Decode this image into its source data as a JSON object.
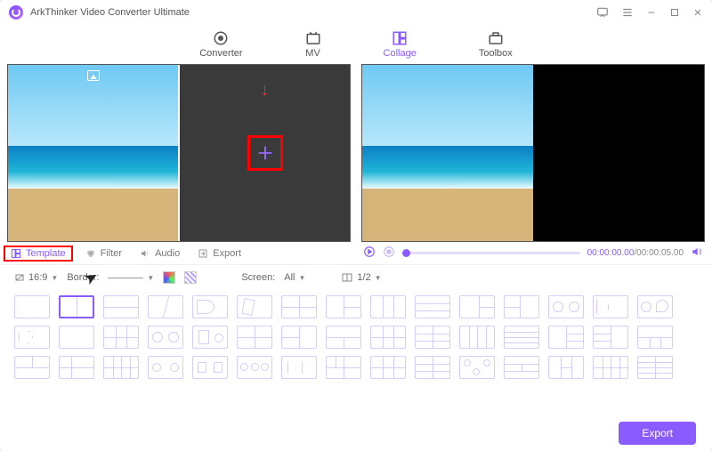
{
  "title": "ArkThinker Video Converter Ultimate",
  "nav": {
    "converter": "Converter",
    "mv": "MV",
    "collage": "Collage",
    "toolbox": "Toolbox"
  },
  "tabs": {
    "template": "Template",
    "filter": "Filter",
    "audio": "Audio",
    "export": "Export"
  },
  "playback": {
    "current": "00:00:00.00",
    "total": "00:00:05.00"
  },
  "options": {
    "aspect": "16:9",
    "border_label": "Border:",
    "screen_label": "Screen:",
    "screen_value": "All",
    "split_value": "1/2"
  },
  "footer": {
    "export": "Export"
  }
}
